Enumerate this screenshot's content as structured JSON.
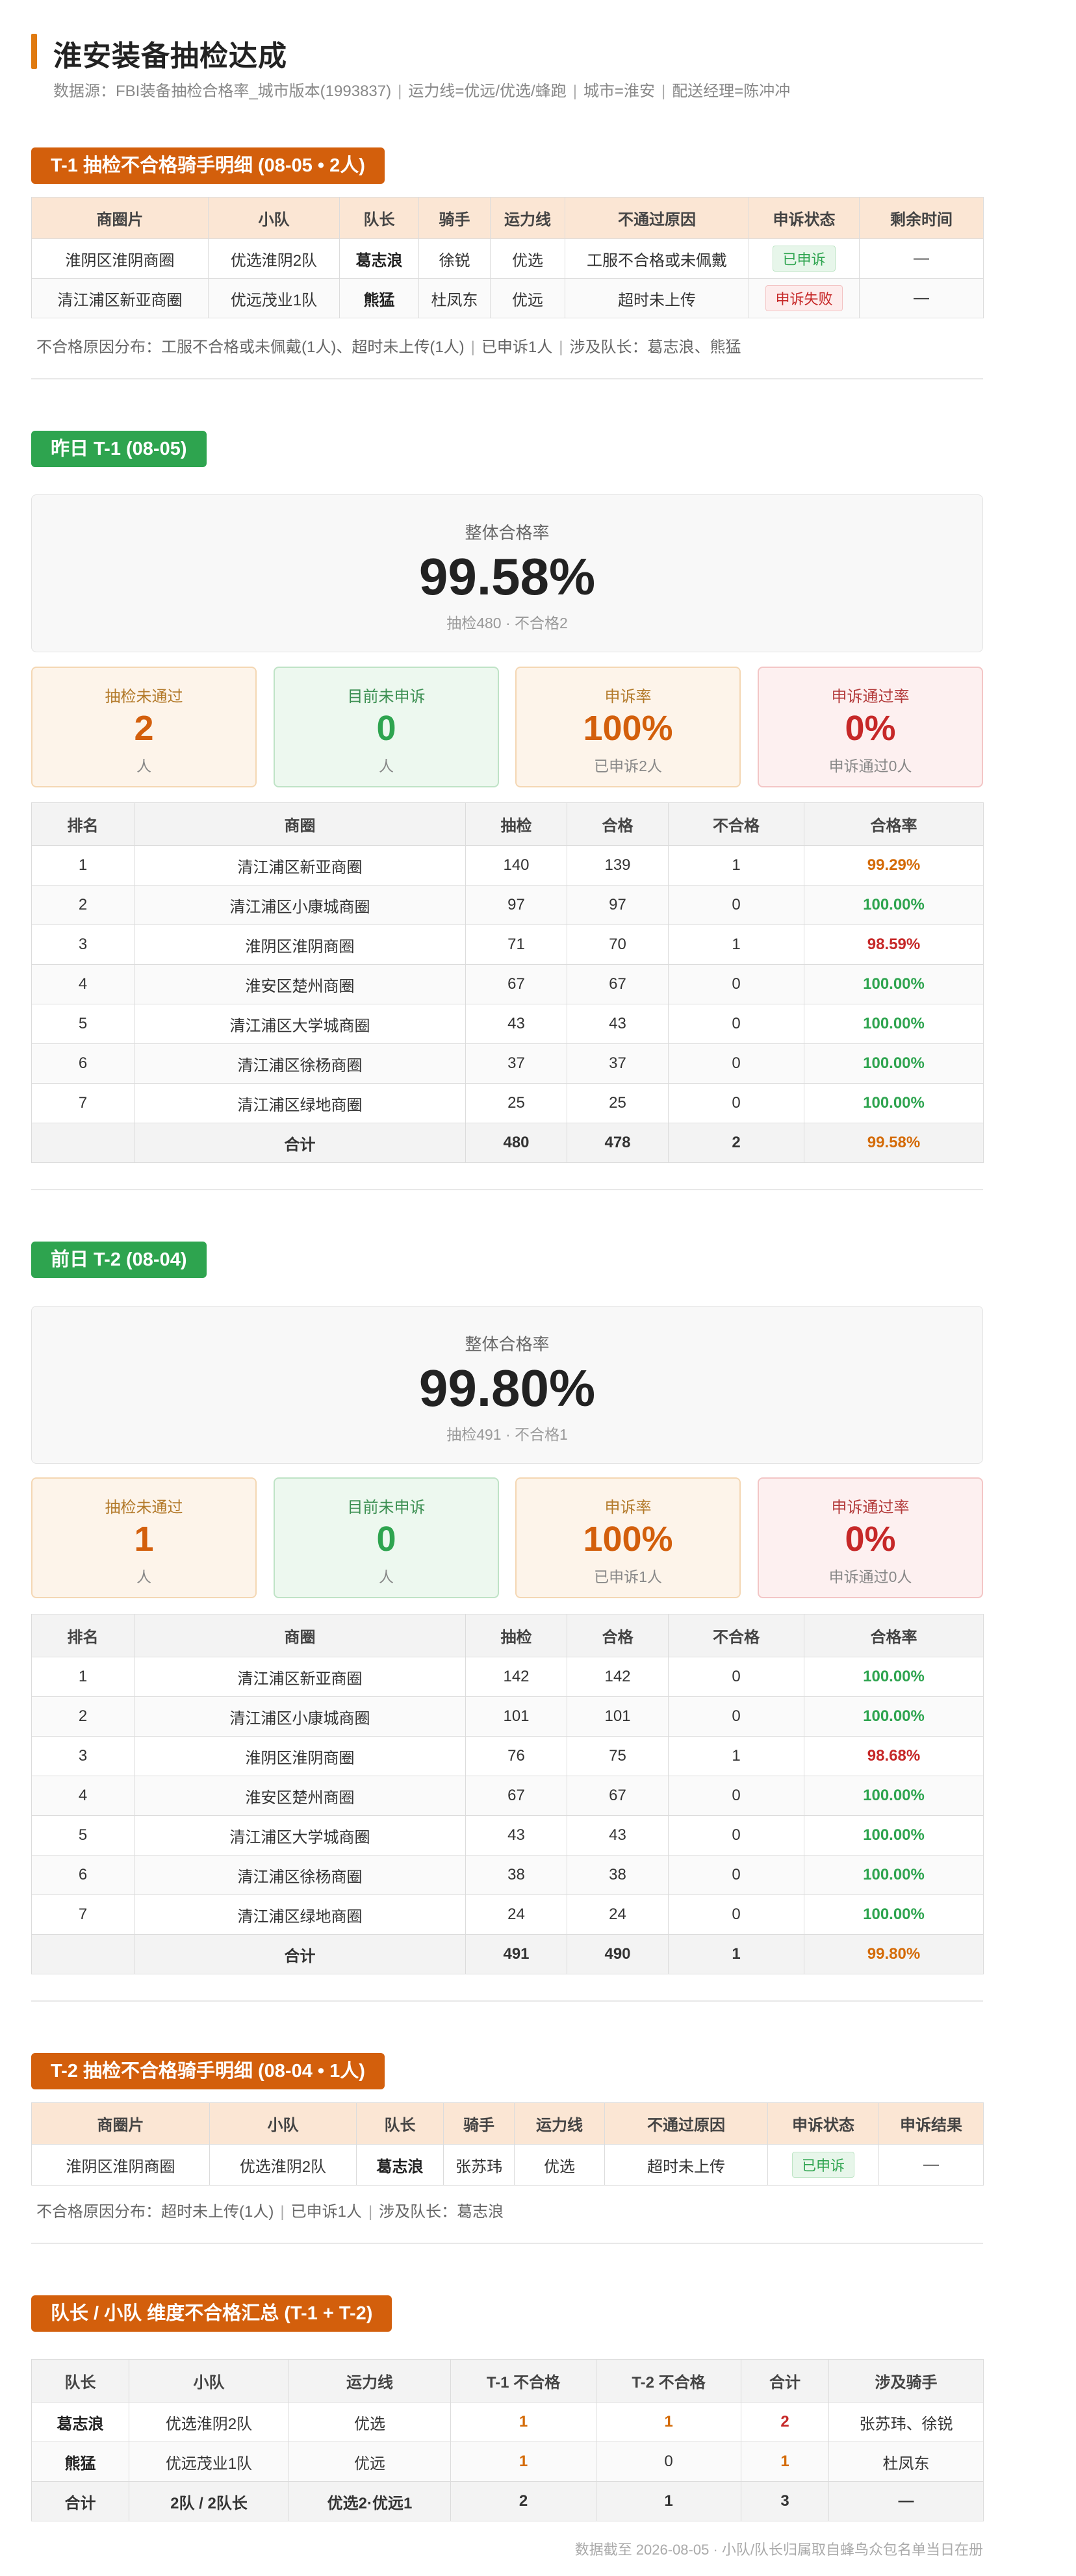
{
  "header": {
    "title": "淮安装备抽检达成",
    "source": "数据源：FBI装备抽检合格率_城市版本(1993837)",
    "capacity": "运力线=优远/优选/蜂跑",
    "city": "城市=淮安",
    "manager": "配送经理=陈冲冲"
  },
  "t1_detail": {
    "tag": "T-1 抽检不合格骑手明细 (08-05 • 2人)",
    "columns": [
      "商圈片",
      "小队",
      "队长",
      "骑手",
      "运力线",
      "不通过原因",
      "申诉状态",
      "剩余时间"
    ],
    "rows": [
      {
        "area": "淮阴区淮阴商圈",
        "team": "优选淮阴2队",
        "captain": "葛志浪",
        "rider": "徐锐",
        "line": "优选",
        "reason": "工服不合格或未佩戴",
        "status": "已申诉",
        "status_type": "green",
        "remain": "—"
      },
      {
        "area": "清江浦区新亚商圈",
        "team": "优远茂业1队",
        "captain": "熊猛",
        "rider": "杜凤东",
        "line": "优远",
        "reason": "超时未上传",
        "status": "申诉失败",
        "status_type": "red",
        "remain": "—"
      }
    ],
    "note_reasons": "不合格原因分布：工服不合格或未佩戴(1人)、超时未上传(1人)",
    "note_appeal": "已申诉1人",
    "note_captains": "涉及队长：葛志浪、熊猛"
  },
  "yesterday": {
    "tag": "昨日 T-1 (08-05)",
    "overall_label": "整体合格率",
    "overall_rate": "99.58%",
    "overall_sub": "抽检480 · 不合格2",
    "cards": [
      {
        "label": "抽检未通过",
        "value": "2",
        "sub": "人"
      },
      {
        "label": "目前未申诉",
        "value": "0",
        "sub": "人"
      },
      {
        "label": "申诉率",
        "value": "100%",
        "sub": "已申诉2人"
      },
      {
        "label": "申诉通过率",
        "value": "0%",
        "sub": "申诉通过0人"
      }
    ],
    "columns": [
      "排名",
      "商圈",
      "抽检",
      "合格",
      "不合格",
      "合格率"
    ],
    "rows": [
      {
        "rank": "1",
        "area": "清江浦区新亚商圈",
        "checked": "140",
        "pass": "139",
        "fail": "1",
        "rate": "99.29%",
        "rate_color": "orange"
      },
      {
        "rank": "2",
        "area": "清江浦区小康城商圈",
        "checked": "97",
        "pass": "97",
        "fail": "0",
        "rate": "100.00%",
        "rate_color": "green"
      },
      {
        "rank": "3",
        "area": "淮阴区淮阴商圈",
        "checked": "71",
        "pass": "70",
        "fail": "1",
        "rate": "98.59%",
        "rate_color": "red"
      },
      {
        "rank": "4",
        "area": "淮安区楚州商圈",
        "checked": "67",
        "pass": "67",
        "fail": "0",
        "rate": "100.00%",
        "rate_color": "green"
      },
      {
        "rank": "5",
        "area": "清江浦区大学城商圈",
        "checked": "43",
        "pass": "43",
        "fail": "0",
        "rate": "100.00%",
        "rate_color": "green"
      },
      {
        "rank": "6",
        "area": "清江浦区徐杨商圈",
        "checked": "37",
        "pass": "37",
        "fail": "0",
        "rate": "100.00%",
        "rate_color": "green"
      },
      {
        "rank": "7",
        "area": "清江浦区绿地商圈",
        "checked": "25",
        "pass": "25",
        "fail": "0",
        "rate": "100.00%",
        "rate_color": "green"
      }
    ],
    "total": {
      "label": "合计",
      "checked": "480",
      "pass": "478",
      "fail": "2",
      "rate": "99.58%"
    }
  },
  "day_before": {
    "tag": "前日 T-2 (08-04)",
    "overall_label": "整体合格率",
    "overall_rate": "99.80%",
    "overall_sub": "抽检491 · 不合格1",
    "cards": [
      {
        "label": "抽检未通过",
        "value": "1",
        "sub": "人"
      },
      {
        "label": "目前未申诉",
        "value": "0",
        "sub": "人"
      },
      {
        "label": "申诉率",
        "value": "100%",
        "sub": "已申诉1人"
      },
      {
        "label": "申诉通过率",
        "value": "0%",
        "sub": "申诉通过0人"
      }
    ],
    "columns": [
      "排名",
      "商圈",
      "抽检",
      "合格",
      "不合格",
      "合格率"
    ],
    "rows": [
      {
        "rank": "1",
        "area": "清江浦区新亚商圈",
        "checked": "142",
        "pass": "142",
        "fail": "0",
        "rate": "100.00%",
        "rate_color": "green"
      },
      {
        "rank": "2",
        "area": "清江浦区小康城商圈",
        "checked": "101",
        "pass": "101",
        "fail": "0",
        "rate": "100.00%",
        "rate_color": "green"
      },
      {
        "rank": "3",
        "area": "淮阴区淮阴商圈",
        "checked": "76",
        "pass": "75",
        "fail": "1",
        "rate": "98.68%",
        "rate_color": "red"
      },
      {
        "rank": "4",
        "area": "淮安区楚州商圈",
        "checked": "67",
        "pass": "67",
        "fail": "0",
        "rate": "100.00%",
        "rate_color": "green"
      },
      {
        "rank": "5",
        "area": "清江浦区大学城商圈",
        "checked": "43",
        "pass": "43",
        "fail": "0",
        "rate": "100.00%",
        "rate_color": "green"
      },
      {
        "rank": "6",
        "area": "清江浦区徐杨商圈",
        "checked": "38",
        "pass": "38",
        "fail": "0",
        "rate": "100.00%",
        "rate_color": "green"
      },
      {
        "rank": "7",
        "area": "清江浦区绿地商圈",
        "checked": "24",
        "pass": "24",
        "fail": "0",
        "rate": "100.00%",
        "rate_color": "green"
      }
    ],
    "total": {
      "label": "合计",
      "checked": "491",
      "pass": "490",
      "fail": "1",
      "rate": "99.80%"
    }
  },
  "t2_detail": {
    "tag": "T-2 抽检不合格骑手明细 (08-04 • 1人)",
    "columns": [
      "商圈片",
      "小队",
      "队长",
      "骑手",
      "运力线",
      "不通过原因",
      "申诉状态",
      "申诉结果"
    ],
    "rows": [
      {
        "area": "淮阴区淮阴商圈",
        "team": "优选淮阴2队",
        "captain": "葛志浪",
        "rider": "张苏玮",
        "line": "优选",
        "reason": "超时未上传",
        "status": "已申诉",
        "status_type": "green",
        "result": "—"
      }
    ],
    "note_reasons": "不合格原因分布：超时未上传(1人)",
    "note_appeal": "已申诉1人",
    "note_captains": "涉及队长：葛志浪"
  },
  "summary": {
    "tag": "队长 / 小队 维度不合格汇总 (T-1 + T-2)",
    "columns": [
      "队长",
      "小队",
      "运力线",
      "T-1 不合格",
      "T-2 不合格",
      "合计",
      "涉及骑手"
    ],
    "rows": [
      {
        "captain": "葛志浪",
        "team": "优选淮阴2队",
        "line": "优选",
        "t1": "1",
        "t2": "1",
        "total": "2",
        "riders": "张苏玮、徐锐"
      },
      {
        "captain": "熊猛",
        "team": "优远茂业1队",
        "line": "优远",
        "t1": "1",
        "t2": "0",
        "total": "1",
        "riders": "杜凤东"
      }
    ],
    "total": {
      "captain": "合计",
      "team": "2队 / 2队长",
      "line": "优选2·优远1",
      "t1": "2",
      "t2": "1",
      "total": "3",
      "riders": "—"
    }
  },
  "footer": "数据截至 2026-08-05 · 小队/队长归属取自蜂鸟众包名单当日在册",
  "colors": {
    "accent_orange": "#d35f0c",
    "accent_green": "#2ea44f",
    "fail_red": "#c62828",
    "warn_orange": "#d46b08"
  }
}
